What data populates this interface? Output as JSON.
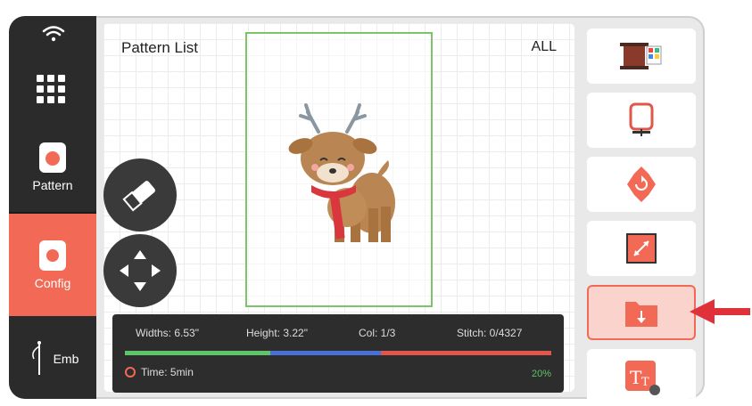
{
  "sidebar": {
    "items": [
      {
        "label": "Pattern"
      },
      {
        "label": "Config"
      },
      {
        "label": "Emb"
      }
    ]
  },
  "main": {
    "title": "Pattern List",
    "filter": "ALL"
  },
  "info": {
    "width": "Widths: 6.53\"",
    "height": "Height: 3.22\"",
    "col": "Col: 1/3",
    "stitch": "Stitch: 0/4327",
    "time": "Time: 5min",
    "percent": "20%",
    "progress": 0.2
  },
  "colors": {
    "accent": "#f26a55",
    "sidebar": "#2b2b2b",
    "hoop": "#7cc46a",
    "progress_green": "#5ec46a",
    "progress_blue": "#4a6fd6",
    "progress_red": "#e0564a"
  },
  "right_tools": [
    {
      "icon": "thread-spool-icon"
    },
    {
      "icon": "hoop-frame-icon"
    },
    {
      "icon": "rotate-icon"
    },
    {
      "icon": "resize-icon"
    },
    {
      "icon": "import-folder-icon"
    },
    {
      "icon": "text-tool-icon"
    }
  ]
}
